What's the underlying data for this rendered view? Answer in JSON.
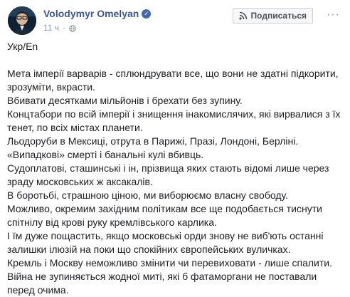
{
  "post": {
    "author": "Volodymyr Omelyan",
    "timestamp": "11 ч",
    "subscribe_label": "Подписаться",
    "more_label": "···",
    "language_tag": "Укр/En",
    "lines": [
      "Мета імперії варварів - сплюндрувати все, що вони не здатні підкорити,",
      "зрозуміти, вкрасти.",
      "Вбивати десятками мільйонів і брехати без зупину.",
      "Концтабори по всій імперії і знищення інакомислячих, які вирвалися з їх",
      "тенет, по всіх містах планети.",
      "Льодоруби в Мексиці, отрута в Парижі, Празі, Лондоні, Берліні.",
      "«Випадкові» смерті і банальні кулі вбивць.",
      "Судоплатові, сташинські і ін, прізвища яких стають відомі лише через",
      "зраду московських ж аксакалів.",
      "В боротьбі, страшною ціною, ми виборюємо власну свободу.",
      "Можливо, окремим західним політикам все ще подобається тиснути",
      "спітнілу від крові руку кремлівського карлика.",
      "І їм дуже пощастить, якщо московські орди знову не виб'ють останні",
      "залишки ілюзій на поки що спокійних європейських вуличках.",
      "Кремль і Москву неможливо змінити чи перевиховати - лише спалити.",
      "Війна не зупиняється жодної миті, які б фатаморгани не поставали",
      "перед очима."
    ]
  },
  "colors": {
    "author": "#385898",
    "verified": "#4267b2",
    "meta": "#90949c",
    "text": "#1c1e21"
  },
  "icons": {
    "verified": "verified-badge-icon",
    "globe": "globe-icon",
    "subscribe": "rss-icon",
    "more": "more-options-icon"
  }
}
